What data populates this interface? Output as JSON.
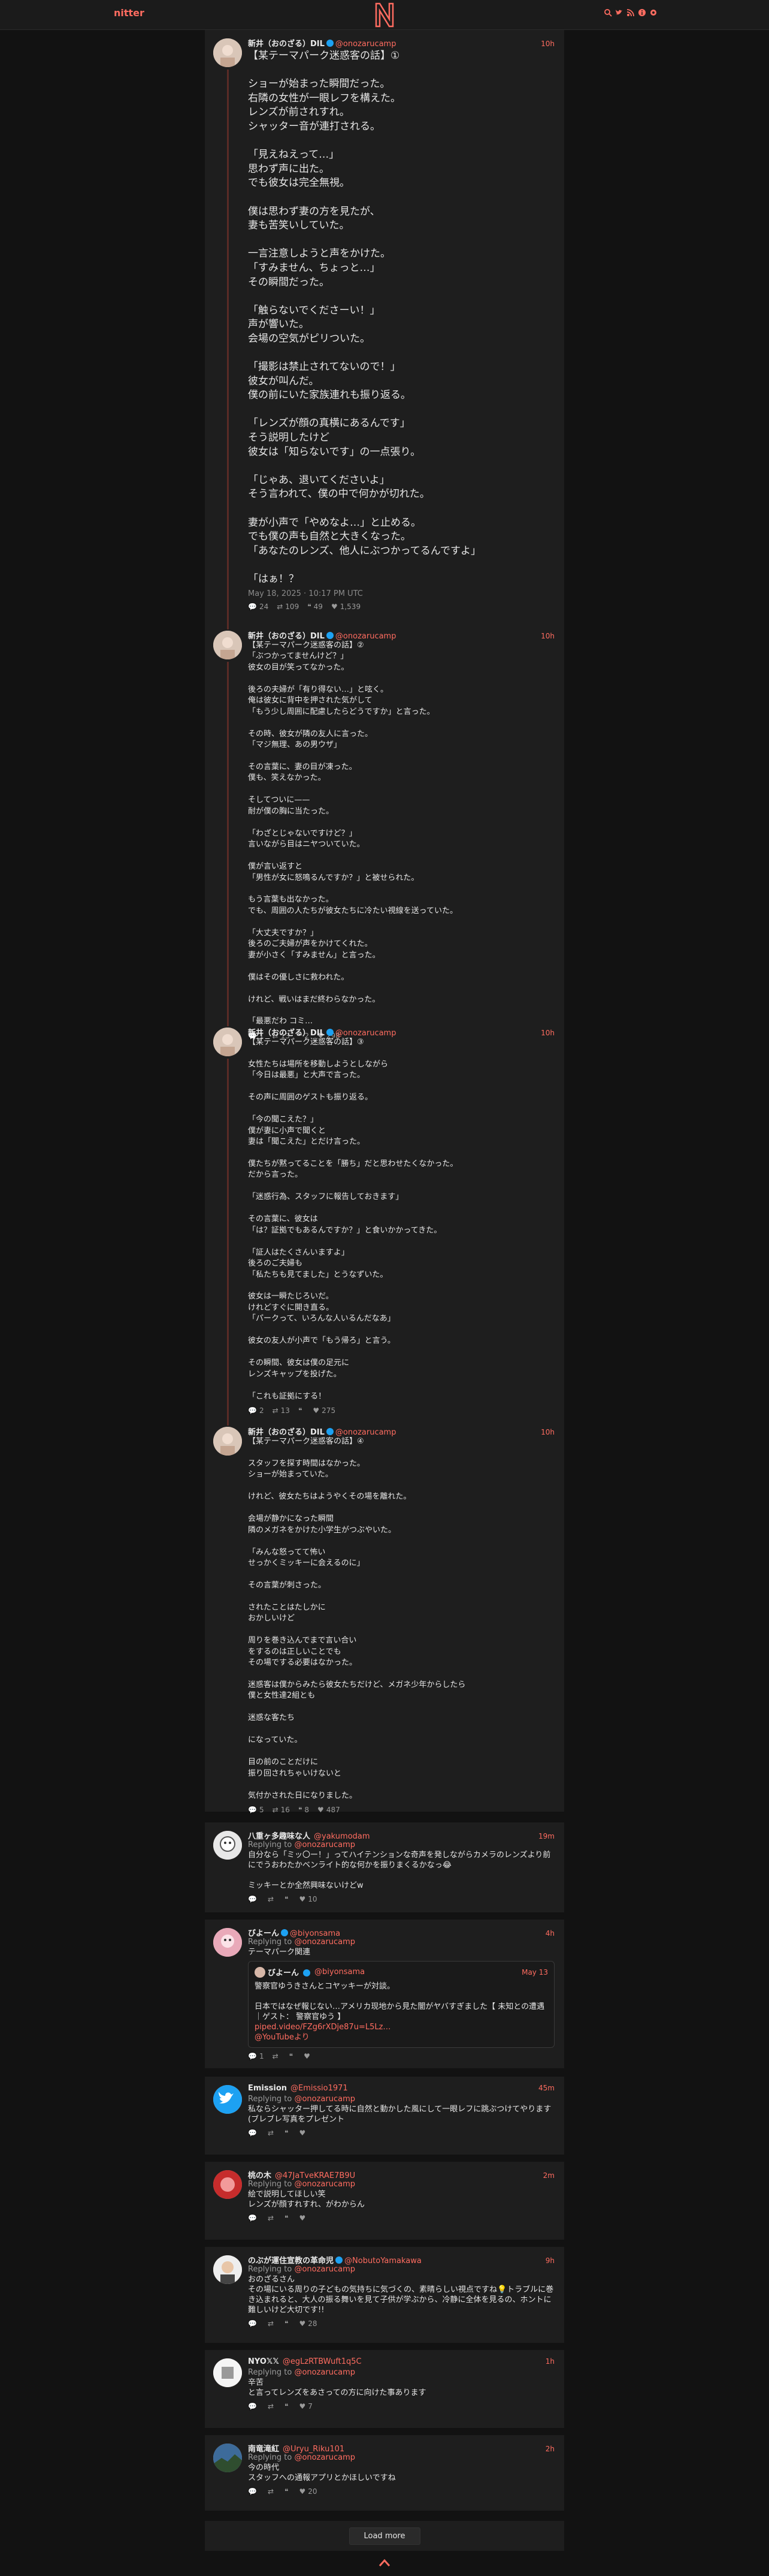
{
  "nav": {
    "brand": "nitter",
    "accent": "#ff6c60"
  },
  "main_tweet": {
    "fullname": "新井（おのざる）DIL",
    "username": "@onozarucamp",
    "date": "10h",
    "body": "【某テーマパーク迷惑客の話】①\n\nショーが始まった瞬間だった。\n右隣の女性が一眼レフを構えた。\nレンズが前されすれ。\nシャッター音が連打される。\n\n「見えねえって…」\n思わず声に出た。\nでも彼女は完全無視。\n\n僕は思わず妻の方を見たが、\n妻も苦笑いしていた。\n\n一言注意しようと声をかけた。\n「すみません、ちょっと…」\nその瞬間だった。\n\n「触らないでくださーい！」\n声が響いた。\n会場の空気がピリついた。\n\n「撮影は禁止されてないので！」\n彼女が叫んだ。\n僕の前にいた家族連れも振り返る。\n\n「レンズが顔の真横にあるんです」\nそう説明したけど\n彼女は「知らないです」の一点張り。\n\n「じゃあ、退いてくださいよ」\nそう言われて、僕の中で何かが切れた。\n\n妻が小声で「やめなよ…」と止める。\nでも僕の声も自然と大きくなった。\n「あなたのレンズ、他人にぶつかってるんですよ」\n\n「はぁ！？",
    "published": "May 18, 2025 · 10:17 PM UTC",
    "stats": {
      "replies": "24",
      "retweets": "109",
      "quotes": "49",
      "likes": "1,539"
    }
  },
  "thread_replies": [
    {
      "fullname": "新井（おのざる）DIL",
      "username": "@onozarucamp",
      "date": "10h",
      "body": "【某テーマパーク迷惑客の話】②\n「ぶつかってませんけど？」\n彼女の目が笑ってなかった。\n\n後ろの夫婦が「有り得ない…」と呟く。\n俺は彼女に背中を押された気がして\n「もう少し周囲に配慮したらどうですか」と言った。\n\nその時、彼女が隣の友人に言った。\n「マジ無理、あの男ウザ」\n\nその言葉に、妻の目が凍った。\n僕も、笑えなかった。\n\nそしてついに——\n耐が僕の胸に当たった。\n\n「わざとじゃないですけど？」\n言いながら目はニヤついていた。\n\n僕が言い返すと\n「男性が女に怒鳴るんですか？」と被せられた。\n\nもう言葉も出なかった。\nでも、周囲の人たちが彼女たちに冷たい視線を送っていた。\n\n「大丈夫ですか？」\n後ろのご夫婦が声をかけてくれた。\n妻が小さく「すみません」と言った。\n\n僕はその優しさに救われた。\n\nけれど、戦いはまだ終わらなかった。\n\n「最悪だわ コミ…",
      "stats": {
        "replies": "1",
        "retweets": "13",
        "quotes": "2",
        "likes": "298"
      }
    },
    {
      "fullname": "新井（おのざる）DIL",
      "username": "@onozarucamp",
      "date": "10h",
      "body": "【某テーマパーク迷惑客の話】③\n\n女性たちは場所を移動しようとしながら\n「今日は最悪」と大声で言った。\n\nその声に周囲のゲストも振り返る。\n\n「今の聞こえた？」\n僕が妻に小声で聞くと\n妻は「聞こえた」とだけ言った。\n\n僕たちが黙ってることを「勝ち」だと思わせたくなかった。\nだから言った。\n\n「迷惑行為、スタッフに報告しておきます」\n\nその言葉に、彼女は\n「は？証拠でもあるんですか？」と食いかかってきた。\n\n「証人はたくさんいますよ」\n後ろのご夫婦も\n「私たちも見てました」とうなずいた。\n\n彼女は一瞬たじろいだ。\nけれどすぐに開き直る。\n「パークって、いろんな人いるんだなあ」\n\n彼女の友人が小声で「もう帰ろ」と言う。\n\nその瞬間、彼女は僕の足元に\nレンズキャップを投げた。\n\n「これも証拠にする！",
      "stats": {
        "replies": "2",
        "retweets": "13",
        "quotes": "",
        "likes": "275"
      }
    },
    {
      "fullname": "新井（おのざる）DIL",
      "username": "@onozarucamp",
      "date": "10h",
      "body": "【某テーマパーク迷惑客の話】④\n\nスタッフを探す時間はなかった。\nショーが始まっていた。\n\nけれど、彼女たちはようやくその場を離れた。\n\n会場が静かになった瞬間\n隣のメガネをかけた小学生がつぶやいた。\n\n「みんな怒ってて怖い\nせっかくミッキーに会えるのに」\n\nその言葉が刺さった。\n\nされたことはたしかに\nおかしいけど\n\n周りを巻き込んでまで言い合い\nをするのは正しいことでも\nその場でする必要はなかった。\n\n迷惑客は僕からみたら彼女たちだけど、メガネ少年からしたら\n僕と女性達2組とも\n\n迷惑な客たち\n\nになっていた。\n\n目の前のことだけに\n振り回されちゃいけないと\n\n気付かされた日になりました。",
      "stats": {
        "replies": "5",
        "retweets": "16",
        "quotes": "8",
        "likes": "487"
      }
    }
  ],
  "replies": [
    {
      "fullname": "八重ヶ多趣味な人",
      "username": "@yakumodam",
      "date": "19m",
      "replying_label": "Replying to",
      "replying_to": "@onozarucamp",
      "body": "自分なら「ミッ〇ー！」ってハイテンションな奇声を発しながらカメラのレンズより前にでうおわたかベンライト的な何かを振りまくるかなっ😂\n\nミッキーとか全然興味ないけどw",
      "stats": {
        "replies": "",
        "retweets": "",
        "quotes": "",
        "likes": "10"
      },
      "verified": false
    },
    {
      "fullname": "びよーん",
      "username": "@biyonsama",
      "date": "4h",
      "replying_label": "Replying to",
      "replying_to": "@onozarucamp",
      "body": "テーマパーク関連",
      "quote": {
        "fullname": "びよーん",
        "username": "@biyonsama",
        "date": "May 13",
        "body": "警察官ゆうきさんとコヤッキーが対談。\n\n日本ではなぜ報じない…アメリカ现地から見た闇がヤバすぎました【 未知との遭遇 ｜ゲスト： 警察官ゆう 】",
        "link": "piped.video/FZg6rXDje87u=L5Lz…",
        "link2": "@YouTubeより"
      },
      "stats": {
        "replies": "1",
        "retweets": "",
        "quotes": "",
        "likes": ""
      },
      "verified": true
    },
    {
      "fullname": "Emission",
      "username": "@Emissio1971",
      "date": "45m",
      "replying_label": "Replying to",
      "replying_to": "@onozarucamp",
      "body": "私ならシャッター押してる時に自然と動かした風にして一眼レフに跳ぶつけてやります(ブレブレ写真をプレゼント",
      "stats": {
        "replies": "",
        "retweets": "",
        "quotes": "",
        "likes": ""
      },
      "verified": false
    },
    {
      "fullname": "桃の木",
      "username": "@47JaTveKRAE7B9U",
      "date": "2m",
      "replying_label": "Replying to",
      "replying_to": "@onozarucamp",
      "body": "絵で説明してほしい笑\nレンズが顔すれすれ、がわからん",
      "stats": {
        "replies": "",
        "retweets": "",
        "quotes": "",
        "likes": ""
      },
      "verified": false
    },
    {
      "fullname": "のぶが運住宣教の革命児",
      "username": "@NobutoYamakawa",
      "date": "9h",
      "replying_label": "Replying to",
      "replying_to": "@onozarucamp",
      "body": "おのざるさん\nその場にいる周りの子どもの気持ちに気づくの、素晴らしい視点ですね💡トラブルに巻き込まれると、大人の振る舞いを見て子供が学ぶから、冷静に全体を見るの、ホントに難しいけど大切です!!",
      "stats": {
        "replies": "",
        "retweets": "",
        "quotes": "",
        "likes": "28"
      },
      "verified": true
    },
    {
      "fullname": "NYO𝕏𝕏",
      "username": "@egLzRTBWuft1q5C",
      "date": "1h",
      "replying_label": "Replying to",
      "replying_to": "@onozarucamp",
      "body": "辛苦\nと言ってレンズをあさっての方に向けた事あります",
      "stats": {
        "replies": "",
        "retweets": "",
        "quotes": "",
        "likes": "7"
      },
      "verified": false
    },
    {
      "fullname": "南竜滝紅",
      "username": "@Uryu_Riku101",
      "date": "2h",
      "replying_label": "Replying to",
      "replying_to": "@onozarucamp",
      "body": "今の時代\nスタッフへの通報アプリとかほしいですね",
      "stats": {
        "replies": "",
        "retweets": "",
        "quotes": "",
        "likes": "20"
      },
      "verified": false
    }
  ],
  "load_more": "Load more"
}
